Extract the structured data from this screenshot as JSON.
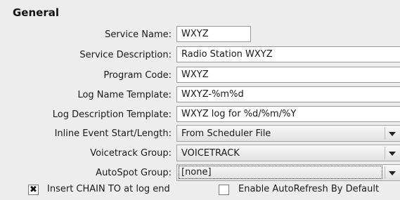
{
  "section_title": "General",
  "fields": {
    "service_name": {
      "label": "Service Name:",
      "value": "WXYZ"
    },
    "service_description": {
      "label": "Service Description:",
      "value": "Radio Station WXYZ"
    },
    "program_code": {
      "label": "Program Code:",
      "value": "WXYZ"
    },
    "log_name_template": {
      "label": "Log Name Template:",
      "value": "WXYZ-%m%d"
    },
    "log_description_template": {
      "label": "Log Description Template:",
      "value": "WXYZ log for %d/%m/%Y"
    },
    "inline_event": {
      "label": "Inline Event Start/Length:",
      "value": "From Scheduler File"
    },
    "voicetrack_group": {
      "label": "Voicetrack Group:",
      "value": "VOICETRACK"
    },
    "autospot_group": {
      "label": "AutoSpot Group:",
      "value": "[none]"
    }
  },
  "checkboxes": {
    "insert_chain": {
      "label": "Insert CHAIN TO at log end",
      "checked": true,
      "mark": "✖"
    },
    "enable_autorefresh": {
      "label": "Enable AutoRefresh By Default",
      "checked": false
    }
  }
}
